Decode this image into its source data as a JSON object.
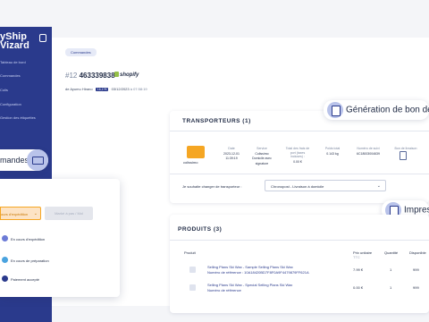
{
  "sidebar": {
    "brand_line1": "yShip",
    "brand_line2": "Vizard",
    "items": [
      {
        "label": "Tableau de bord"
      },
      {
        "label": "Commandes"
      },
      {
        "label": "Colis"
      },
      {
        "label": "Configuration"
      },
      {
        "label": "Gestion des étiquettes"
      }
    ]
  },
  "commandes_pill": {
    "label": "mandes"
  },
  "breadcrumb": {
    "label": "Commandes"
  },
  "order": {
    "hash": "#12",
    "number": "463339838",
    "platform": "shopify",
    "by": "de Ayumu Hirano",
    "badge": "16,17€",
    "date": "03/12/2023",
    "time": "à 07:58:19"
  },
  "transporteurs": {
    "title": "TRANSPORTEURS (1)",
    "carrier": "colissimo",
    "columns": [
      {
        "header": "Date",
        "value1": "2023-12-01",
        "value2": "11:39:19"
      },
      {
        "header": "Service",
        "value1": "Colissimo",
        "value2": "Domicile avec",
        "value3": "signature"
      },
      {
        "header": "Total des frais de",
        "header2": "port (taxes",
        "header3": "incluses) :",
        "value1": "0.00 €"
      },
      {
        "header": "Poids total",
        "value1": "0.143 kg"
      },
      {
        "header": "Numéro de suivi",
        "value1": "6C18003004639"
      },
      {
        "header": "Bon de livraison"
      }
    ],
    "change_label": "Je souhaite changer de transporteur :",
    "select_value": "Chronopost - Livraison à domicile"
  },
  "floating": {
    "generation": "Génération de bon de liv",
    "impress": "Impress"
  },
  "popover": {
    "dropdown_label": "ours d'expédition",
    "disabled_label": "Marké à pas / Mol",
    "statuses": [
      {
        "label": "En cours d'expédition",
        "color": "#6c7bd6"
      },
      {
        "label": "En cours de préparation",
        "color": "#4aa3df"
      },
      {
        "label": "Paiement accepté",
        "color": "#2a3a8c"
      }
    ]
  },
  "produits": {
    "title": "PRODUITS (3)",
    "headers": {
      "product": "Produit",
      "price": "Prix unitaire",
      "price_sub": "TTC",
      "quantity": "Quantité",
      "available": "Disponible"
    },
    "rows": [
      {
        "name": "Selling Plans Ski Wax - Sample Selling Plans Ski Wax",
        "ref": "Numéro de référence : 10A18420BD7F8F0A9F4479879FF621A",
        "price": "7.99 €",
        "quantity": "1",
        "available": "999"
      },
      {
        "name": "Selling Plans Ski Wax - Special Selling Plans Ski Wax",
        "ref": "Numéro de référence",
        "price": "0.00 €",
        "quantity": "1",
        "available": "999"
      }
    ]
  }
}
